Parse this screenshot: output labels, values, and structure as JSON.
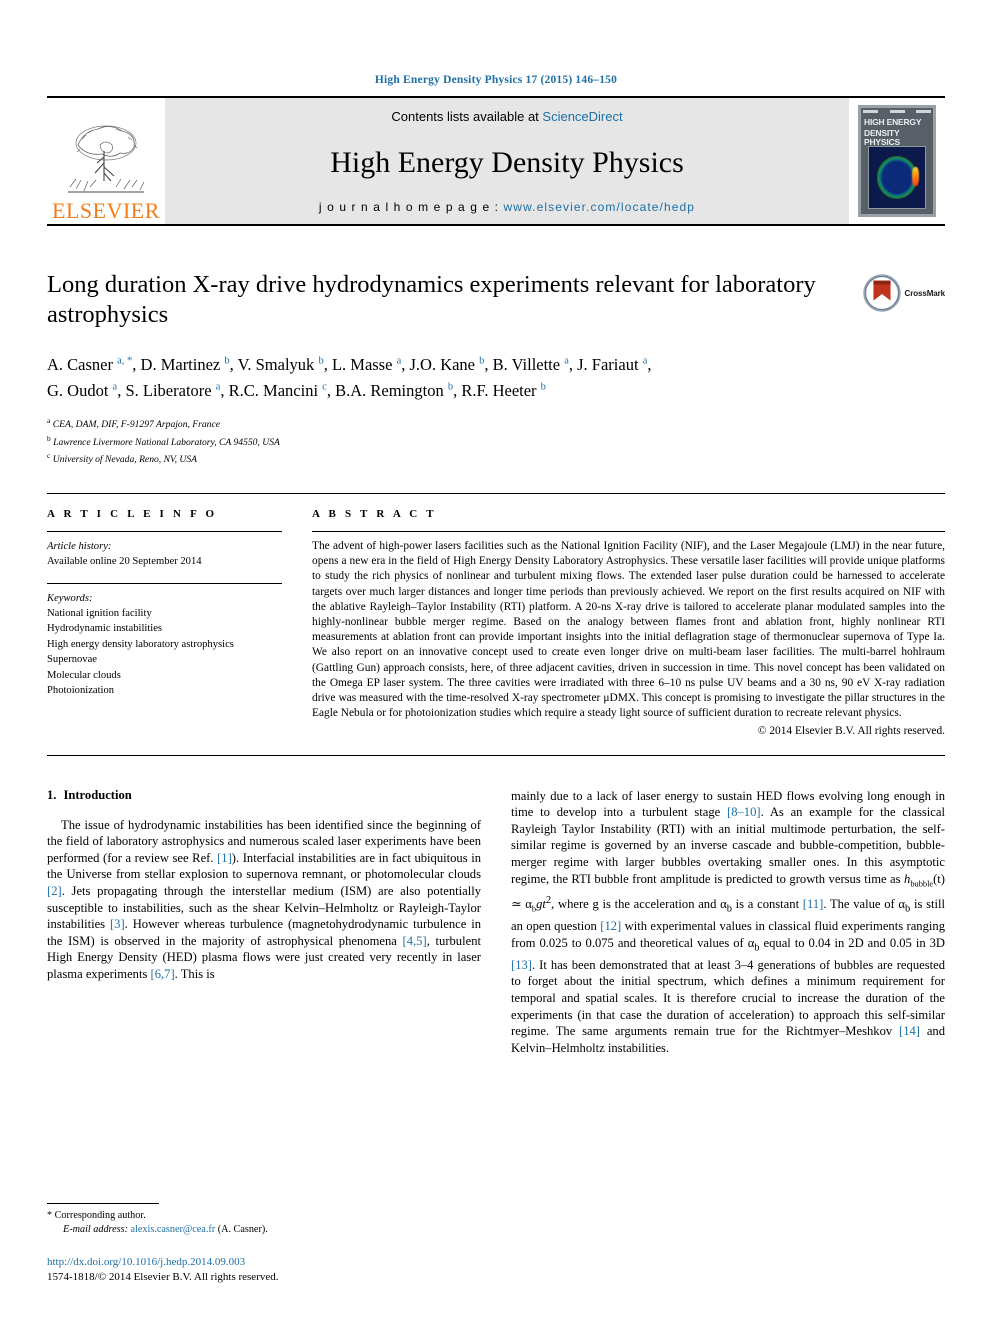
{
  "running_head": "High Energy Density Physics 17 (2015) 146–150",
  "masthead": {
    "contents_prefix": "Contents lists available at ",
    "sciencedirect": "ScienceDirect",
    "journal_name": "High Energy Density Physics",
    "homepage_prefix": "j o u r n a l   h o m e p a g e :  ",
    "homepage_url": "www.elsevier.com/locate/hedp",
    "publisher": "ELSEVIER",
    "cover_title_line1": "HIGH ENERGY",
    "cover_title_line2": "DENSITY PHYSICS",
    "accent_blue": "#1d6fa5",
    "accent_orange": "#f07d1a",
    "masthead_bg": "#e6e6e6"
  },
  "article": {
    "title": "Long duration X-ray drive hydrodynamics experiments relevant for laboratory astrophysics",
    "crossmark_label": "CrossMark",
    "authors": [
      {
        "name": "A. Casner",
        "marks": "a, *"
      },
      {
        "name": "D. Martinez",
        "marks": "b"
      },
      {
        "name": "V. Smalyuk",
        "marks": "b"
      },
      {
        "name": "L. Masse",
        "marks": "a"
      },
      {
        "name": "J.O. Kane",
        "marks": "b"
      },
      {
        "name": "B. Villette",
        "marks": "a"
      },
      {
        "name": "J. Fariaut",
        "marks": "a"
      },
      {
        "name": "G. Oudot",
        "marks": "a"
      },
      {
        "name": "S. Liberatore",
        "marks": "a"
      },
      {
        "name": "R.C. Mancini",
        "marks": "c"
      },
      {
        "name": "B.A. Remington",
        "marks": "b"
      },
      {
        "name": "R.F. Heeter",
        "marks": "b"
      }
    ],
    "affiliations": [
      {
        "mark": "a",
        "text": "CEA, DAM, DIF, F-91297 Arpajon, France"
      },
      {
        "mark": "b",
        "text": "Lawrence Livermore National Laboratory, CA 94550, USA"
      },
      {
        "mark": "c",
        "text": "University of Nevada, Reno, NV, USA"
      }
    ]
  },
  "article_info": {
    "heading": "A R T I C L E   I N F O",
    "history_label": "Article history:",
    "history_value": "Available online 20 September 2014",
    "keywords_label": "Keywords:",
    "keywords": [
      "National ignition facility",
      "Hydrodynamic instabilities",
      "High energy density laboratory astrophysics",
      "Supernovae",
      "Molecular clouds",
      "Photoionization"
    ]
  },
  "abstract": {
    "heading": "A B S T R A C T",
    "text": "The advent of high-power lasers facilities such as the National Ignition Facility (NIF), and the Laser Megajoule (LMJ) in the near future, opens a new era in the field of High Energy Density Laboratory Astrophysics. These versatile laser facilities will provide unique platforms to study the rich physics of nonlinear and turbulent mixing flows. The extended laser pulse duration could be harnessed to accelerate targets over much larger distances and longer time periods than previously achieved. We report on the first results acquired on NIF with the ablative Rayleigh–Taylor Instability (RTI) platform. A 20-ns X-ray drive is tailored to accelerate planar modulated samples into the highly-nonlinear bubble merger regime. Based on the analogy between flames front and ablation front, highly nonlinear RTI measurements at ablation front can provide important insights into the initial deflagration stage of thermonuclear supernova of Type Ia. We also report on an innovative concept used to create even longer drive on multi-beam laser facilities. The multi-barrel hohlraum (Gattling Gun) approach consists, here, of three adjacent cavities, driven in succession in time. This novel concept has been validated on the Omega EP laser system. The three cavities were irradiated with three 6–10 ns pulse UV beams and a 30 ns, 90 eV X-ray radiation drive was measured with the time-resolved X-ray spectrometer μDMX. This concept is promising to investigate the pillar structures in the Eagle Nebula or for photoionization studies which require a steady light source of sufficient duration to recreate relevant physics.",
    "copyright": "© 2014 Elsevier B.V. All rights reserved."
  },
  "introduction": {
    "number": "1.",
    "heading": "Introduction",
    "left_p1_a": "The issue of hydrodynamic instabilities has been identified since the beginning of the field of laboratory astrophysics and numerous scaled laser experiments have been performed (for a review see Ref. ",
    "cite1": "[1]",
    "left_p1_b": "). Interfacial instabilities are in fact ubiquitous in the Universe from stellar explosion to supernova remnant, or photomolecular clouds ",
    "cite2": "[2]",
    "left_p1_c": ". Jets propagating through the interstellar medium (ISM) are also potentially susceptible to instabilities, such as the shear Kelvin–Helmholtz or Rayleigh-Taylor instabilities ",
    "cite3": "[3]",
    "left_p1_d": ". However whereas turbulence (magnetohydrodynamic turbulence in the ISM) is observed in the majority of astrophysical phenomena ",
    "cite45": "[4,5]",
    "left_p1_e": ", turbulent High Energy Density (HED) plasma flows were just created very recently in laser plasma experiments ",
    "cite67": "[6,7]",
    "left_p1_f": ". This is",
    "right_p1_a": "mainly due to a lack of laser energy to sustain HED flows evolving long enough in time to develop into a turbulent stage ",
    "cite810": "[8–10]",
    "right_p1_b": ". As an example for the classical Rayleigh Taylor Instability (RTI) with an initial multimode perturbation, the self-similar regime is governed by an inverse cascade and bubble-competition, bubble-merger regime with larger bubbles overtaking smaller ones. In this asymptotic regime, the RTI bubble front amplitude is predicted to growth versus time as ",
    "formula_h": "h",
    "formula_sub": "bubble",
    "formula_mid": "(t) ≃ α",
    "formula_sub2": "b",
    "formula_tail": "gt",
    "formula_exp": "2",
    "right_p1_c": ", where g is the acceleration and α",
    "right_p1_c2": " is a constant ",
    "cite11": "[11]",
    "right_p1_d": ". The value of α",
    "right_p1_d2": " is still an open question ",
    "cite12": "[12]",
    "right_p1_e": " with experimental values in classical fluid experiments ranging from 0.025 to 0.075 and theoretical values of α",
    "right_p1_e2": " equal to 0.04 in 2D and 0.05 in 3D ",
    "cite13": "[13]",
    "right_p1_f": ". It has been demonstrated that at least 3–4 generations of bubbles are requested to forget about the initial spectrum, which defines a minimum requirement for temporal and spatial scales. It is therefore crucial to increase the duration of the experiments (in that case the duration of acceleration) to approach this self-similar regime. The same arguments remain true for the Richtmyer–Meshkov ",
    "cite14": "[14]",
    "right_p1_g": " and Kelvin–Helmholtz instabilities."
  },
  "footer": {
    "corresponding": "* Corresponding author.",
    "email_label": "E-mail address:",
    "email": "alexis.casner@cea.fr",
    "email_suffix": " (A. Casner).",
    "doi": "http://dx.doi.org/10.1016/j.hedp.2014.09.003",
    "issn": "1574-1818/© 2014 Elsevier B.V. All rights reserved."
  }
}
